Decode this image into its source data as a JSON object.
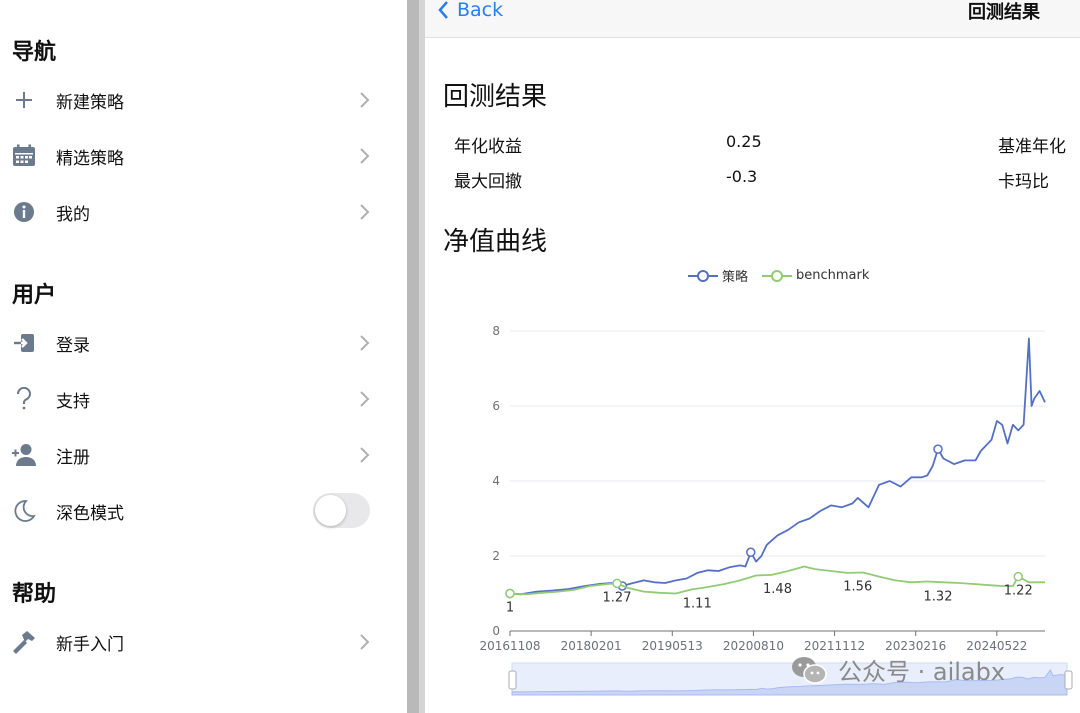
{
  "sidebar": {
    "sections": [
      {
        "title": "导航",
        "items": [
          {
            "label": "新建策略",
            "icon": "plus-icon"
          },
          {
            "label": "精选策略",
            "icon": "calendar-icon"
          },
          {
            "label": "我的",
            "icon": "info-icon"
          }
        ]
      },
      {
        "title": "用户",
        "items": [
          {
            "label": "登录",
            "icon": "login-icon"
          },
          {
            "label": "支持",
            "icon": "question-icon"
          },
          {
            "label": "注册",
            "icon": "add-user-icon"
          },
          {
            "label": "深色模式",
            "icon": "moon-icon",
            "toggle": false
          }
        ]
      },
      {
        "title": "帮助",
        "items": [
          {
            "label": "新手入门",
            "icon": "hammer-icon"
          }
        ]
      }
    ]
  },
  "topbar": {
    "back_label": "Back",
    "title": "回测结果"
  },
  "main": {
    "results_title": "回测结果",
    "metrics": [
      {
        "label": "年化收益",
        "value": "0.25"
      },
      {
        "label": "最大回撤",
        "value": "-0.3"
      }
    ],
    "metrics_right": [
      "基准年化",
      "卡玛比"
    ],
    "curve_title": "净值曲线"
  },
  "colors": {
    "strategy": "#5470c6",
    "benchmark": "#91cc75",
    "accent": "#2a7cf0"
  },
  "chart_data": {
    "type": "line",
    "legend": [
      "策略",
      "benchmark"
    ],
    "x_ticks": [
      "20161108",
      "20180201",
      "20190513",
      "20200810",
      "20211112",
      "20230216",
      "20240522"
    ],
    "ylim": [
      0,
      8
    ],
    "y_ticks": [
      0,
      2,
      4,
      6,
      8
    ],
    "series": [
      {
        "name": "策略",
        "points": [
          [
            0,
            1.0
          ],
          [
            0.02,
            0.98
          ],
          [
            0.05,
            1.05
          ],
          [
            0.08,
            1.08
          ],
          [
            0.11,
            1.12
          ],
          [
            0.14,
            1.2
          ],
          [
            0.17,
            1.26
          ],
          [
            0.19,
            1.28
          ],
          [
            0.21,
            1.2
          ],
          [
            0.23,
            1.28
          ],
          [
            0.25,
            1.35
          ],
          [
            0.27,
            1.3
          ],
          [
            0.29,
            1.28
          ],
          [
            0.31,
            1.35
          ],
          [
            0.33,
            1.4
          ],
          [
            0.35,
            1.55
          ],
          [
            0.37,
            1.62
          ],
          [
            0.39,
            1.6
          ],
          [
            0.41,
            1.7
          ],
          [
            0.43,
            1.75
          ],
          [
            0.44,
            1.72
          ],
          [
            0.45,
            2.1
          ],
          [
            0.46,
            1.85
          ],
          [
            0.47,
            2.0
          ],
          [
            0.48,
            2.3
          ],
          [
            0.5,
            2.55
          ],
          [
            0.52,
            2.7
          ],
          [
            0.54,
            2.9
          ],
          [
            0.56,
            3.0
          ],
          [
            0.58,
            3.2
          ],
          [
            0.6,
            3.35
          ],
          [
            0.62,
            3.3
          ],
          [
            0.64,
            3.4
          ],
          [
            0.65,
            3.55
          ],
          [
            0.67,
            3.3
          ],
          [
            0.68,
            3.6
          ],
          [
            0.69,
            3.9
          ],
          [
            0.71,
            4.0
          ],
          [
            0.73,
            3.85
          ],
          [
            0.75,
            4.1
          ],
          [
            0.77,
            4.1
          ],
          [
            0.78,
            4.15
          ],
          [
            0.79,
            4.4
          ],
          [
            0.8,
            4.85
          ],
          [
            0.81,
            4.6
          ],
          [
            0.83,
            4.45
          ],
          [
            0.85,
            4.55
          ],
          [
            0.87,
            4.55
          ],
          [
            0.88,
            4.8
          ],
          [
            0.9,
            5.1
          ],
          [
            0.91,
            5.6
          ],
          [
            0.92,
            5.5
          ],
          [
            0.93,
            5.0
          ],
          [
            0.94,
            5.5
          ],
          [
            0.95,
            5.35
          ],
          [
            0.96,
            5.5
          ],
          [
            0.97,
            7.8
          ],
          [
            0.975,
            6.0
          ],
          [
            0.98,
            6.2
          ],
          [
            0.99,
            6.4
          ],
          [
            1.0,
            6.1
          ]
        ],
        "labels": []
      },
      {
        "name": "benchmark",
        "points": [
          [
            0,
            1.0
          ],
          [
            0.03,
            0.98
          ],
          [
            0.06,
            1.02
          ],
          [
            0.09,
            1.05
          ],
          [
            0.12,
            1.1
          ],
          [
            0.15,
            1.2
          ],
          [
            0.18,
            1.25
          ],
          [
            0.2,
            1.27
          ],
          [
            0.22,
            1.15
          ],
          [
            0.25,
            1.05
          ],
          [
            0.28,
            1.02
          ],
          [
            0.31,
            1.0
          ],
          [
            0.34,
            1.11
          ],
          [
            0.36,
            1.15
          ],
          [
            0.4,
            1.25
          ],
          [
            0.43,
            1.35
          ],
          [
            0.46,
            1.48
          ],
          [
            0.49,
            1.5
          ],
          [
            0.52,
            1.6
          ],
          [
            0.55,
            1.72
          ],
          [
            0.57,
            1.65
          ],
          [
            0.6,
            1.6
          ],
          [
            0.63,
            1.55
          ],
          [
            0.66,
            1.56
          ],
          [
            0.69,
            1.45
          ],
          [
            0.72,
            1.35
          ],
          [
            0.75,
            1.3
          ],
          [
            0.78,
            1.32
          ],
          [
            0.81,
            1.3
          ],
          [
            0.84,
            1.28
          ],
          [
            0.87,
            1.25
          ],
          [
            0.9,
            1.22
          ],
          [
            0.92,
            1.2
          ],
          [
            0.94,
            1.2
          ],
          [
            0.95,
            1.45
          ],
          [
            0.97,
            1.3
          ],
          [
            1.0,
            1.3
          ]
        ],
        "labels": []
      }
    ],
    "point_labels": [
      {
        "x": 0.0,
        "value": "1"
      },
      {
        "x": 0.2,
        "value": "1.27"
      },
      {
        "x": 0.35,
        "value": "1.11"
      },
      {
        "x": 0.5,
        "value": "1.48"
      },
      {
        "x": 0.65,
        "value": "1.56"
      },
      {
        "x": 0.8,
        "value": "1.32"
      },
      {
        "x": 0.95,
        "value": "1.22"
      }
    ]
  },
  "watermark": {
    "text": "公众号 · ailabx"
  }
}
